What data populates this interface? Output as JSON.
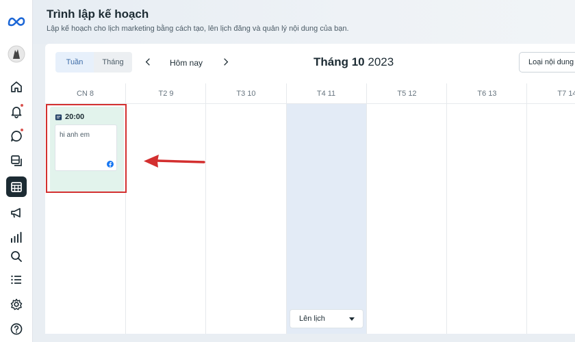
{
  "header": {
    "title": "Trình lập kế hoạch",
    "subtitle": "Lập kế hoạch cho lịch marketing bằng cách tạo, lên lịch đăng và quản lý nội dung của bạn."
  },
  "toolbar": {
    "week_label": "Tuần",
    "month_label": "Tháng",
    "today_label": "Hôm nay",
    "month_name": "Tháng 10",
    "year": "2023",
    "content_type_label": "Loại nội dung"
  },
  "days": [
    "CN 8",
    "T2 9",
    "T3 10",
    "T4 11",
    "T5 12",
    "T6 13",
    "T7 14"
  ],
  "event": {
    "time": "20:00",
    "text": "hi anh em"
  },
  "schedule_button": {
    "label": "Lên lịch"
  },
  "colors": {
    "accent": "#3b6aa6",
    "highlight": "#d32f2f",
    "event_bg": "#e2f3ec",
    "today_column": "#e3ebf6"
  },
  "sidebar": {
    "items": [
      "meta-logo",
      "avatar",
      "home-icon",
      "bell-icon",
      "chat-icon",
      "pages-icon",
      "planner-icon",
      "megaphone-icon",
      "insights-icon",
      "search-icon",
      "list-icon",
      "settings-icon",
      "help-icon"
    ]
  }
}
